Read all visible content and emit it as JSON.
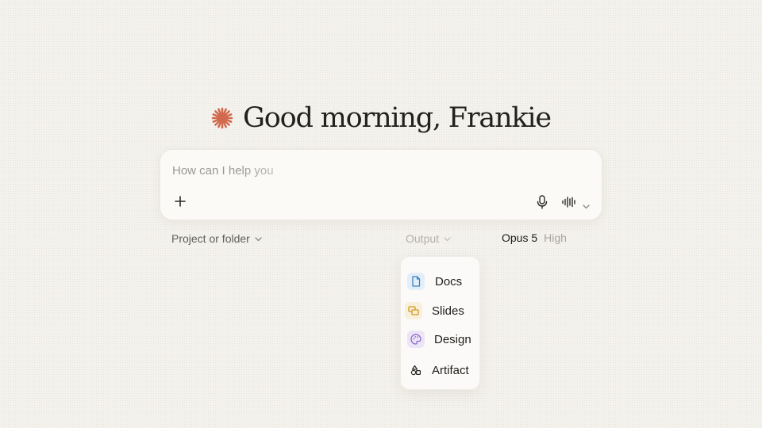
{
  "greeting": {
    "text": "Good morning, Frankie",
    "logo_icon": "starburst-icon",
    "logo_color": "#d1694e"
  },
  "composer": {
    "placeholder": "How can I help you",
    "add_icon": "plus-icon",
    "add_label": "+",
    "mic_icon": "microphone-icon",
    "voice_icon": "waveform-icon",
    "voice_menu_icon": "chevron-down-icon"
  },
  "toolbar": {
    "project_label": "Project or folder",
    "output_label": "Output",
    "model_name": "Opus 5",
    "model_effort": "High"
  },
  "output_menu": {
    "items": [
      {
        "label": "Docs",
        "icon": "document-icon",
        "color": "#3b82c4",
        "bg": "#e3eef8"
      },
      {
        "label": "Slides",
        "icon": "slides-icon",
        "color": "#d49a1e",
        "bg": "#f8efdc"
      },
      {
        "label": "Design",
        "icon": "palette-icon",
        "color": "#8a63c9",
        "bg": "#ece5f6"
      },
      {
        "label": "Artifact",
        "icon": "shapes-icon",
        "color": "#2a2926",
        "bg": "transparent"
      }
    ]
  }
}
